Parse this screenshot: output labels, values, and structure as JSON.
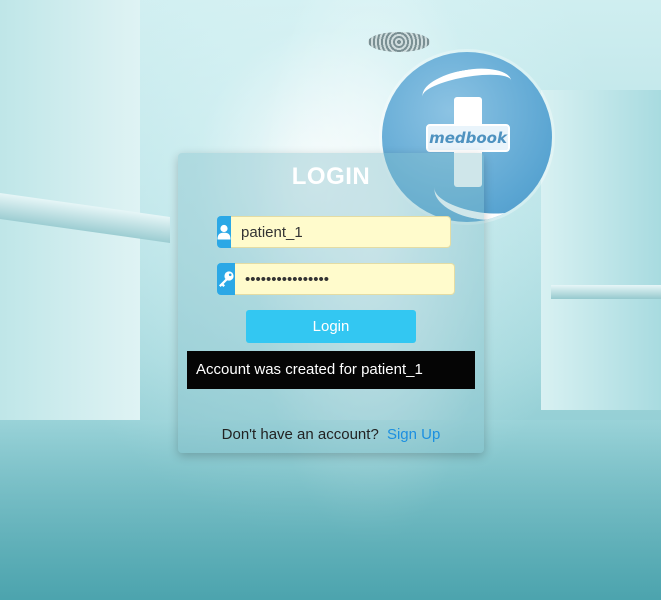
{
  "logo": {
    "wordmark": "medbook"
  },
  "login": {
    "title": "LOGIN",
    "username_value": "patient_1",
    "password_value": "••••••••••••••••",
    "submit_label": "Login",
    "alert_message": "Account was created for patient_1",
    "signup_prompt": "Don't have an account?",
    "signup_link": "Sign Up"
  },
  "icons": {
    "username": "user-icon",
    "password": "key-icon"
  },
  "colors": {
    "icon_bg": "#2ba8e6",
    "input_bg": "#fffbcc",
    "button_bg": "#33c7f2",
    "alert_bg": "#050505",
    "link": "#1c8fe0"
  }
}
